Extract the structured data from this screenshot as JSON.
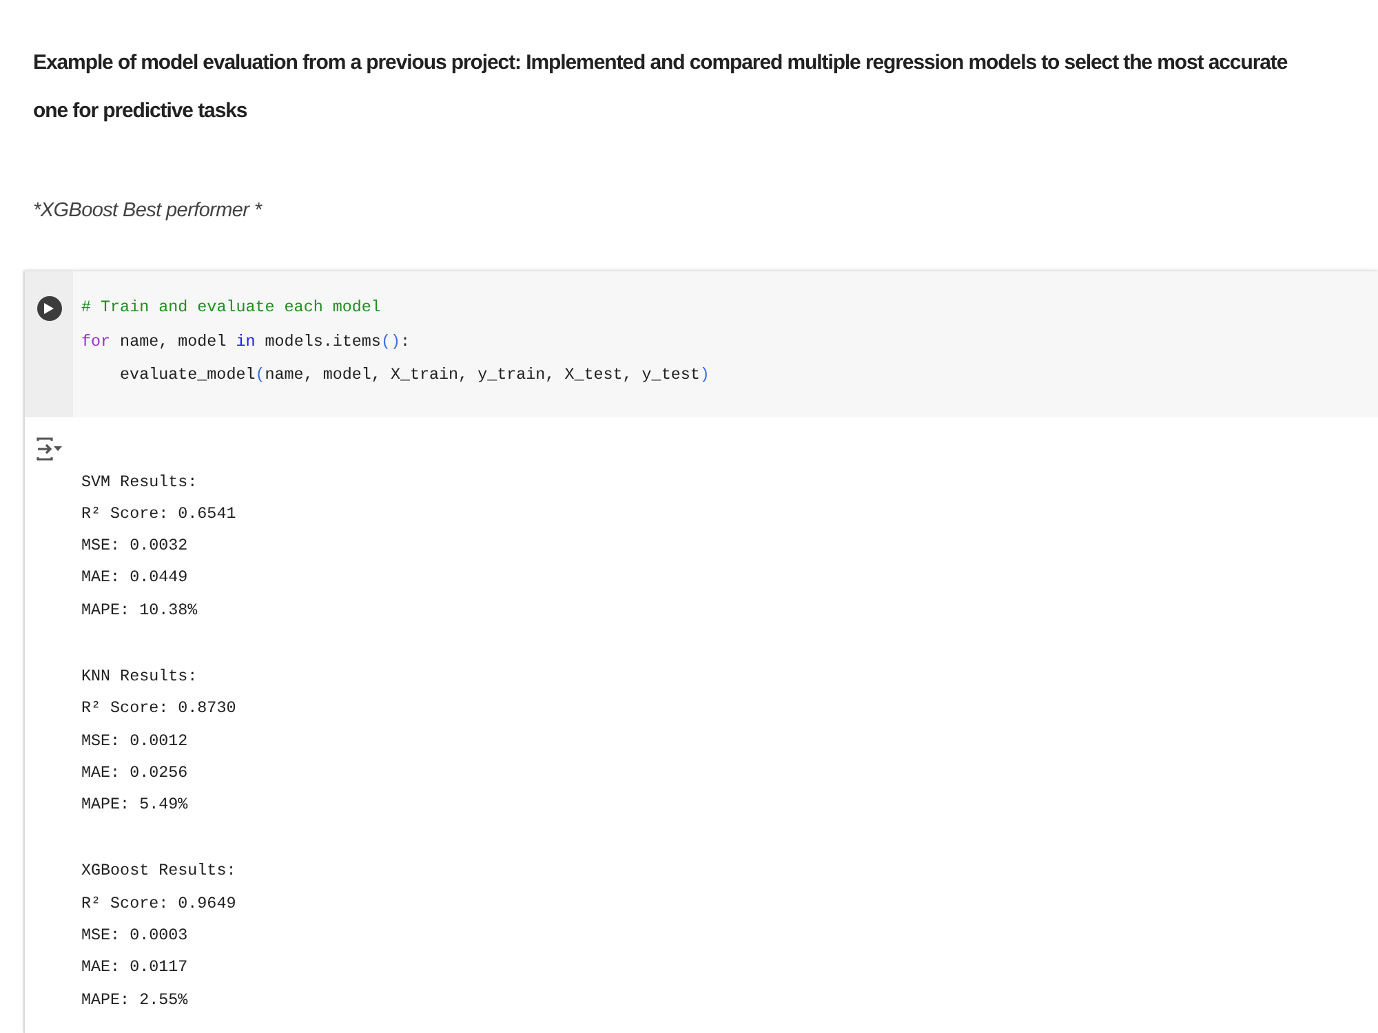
{
  "markdown": {
    "heading": "Example of model evaluation from a previous project: Implemented and compared multiple regression models to select the most accurate one for predictive tasks",
    "note": "*XGBoost Best performer *"
  },
  "code_cell": {
    "lines": [
      {
        "indented": false,
        "tokens": [
          {
            "kind": "comment",
            "text": "# Train and evaluate each model"
          }
        ]
      },
      {
        "indented": false,
        "tokens": [
          {
            "kind": "keyword",
            "text": "for"
          },
          {
            "kind": "plain",
            "text": " name, model "
          },
          {
            "kind": "operator",
            "text": "in"
          },
          {
            "kind": "plain",
            "text": " models.items"
          },
          {
            "kind": "bracket",
            "text": "()"
          },
          {
            "kind": "plain",
            "text": ":"
          }
        ]
      },
      {
        "indented": true,
        "tokens": [
          {
            "kind": "plain",
            "text": "evaluate_model"
          },
          {
            "kind": "bracket",
            "text": "("
          },
          {
            "kind": "plain",
            "text": "name, model, X_train, y_train, X_test, y_test"
          },
          {
            "kind": "bracket",
            "text": ")"
          }
        ]
      }
    ]
  },
  "output": {
    "blocks": [
      {
        "title": "SVM Results:",
        "lines": [
          "R² Score: 0.6541",
          "MSE: 0.0032",
          "MAE: 0.0449",
          "MAPE: 10.38%"
        ]
      },
      {
        "title": "KNN Results:",
        "lines": [
          "R² Score: 0.8730",
          "MSE: 0.0012",
          "MAE: 0.0256",
          "MAPE: 5.49%"
        ]
      },
      {
        "title": "XGBoost Results:",
        "lines": [
          "R² Score: 0.9649",
          "MSE: 0.0003",
          "MAE: 0.0117",
          "MAPE: 2.55%"
        ]
      }
    ]
  }
}
